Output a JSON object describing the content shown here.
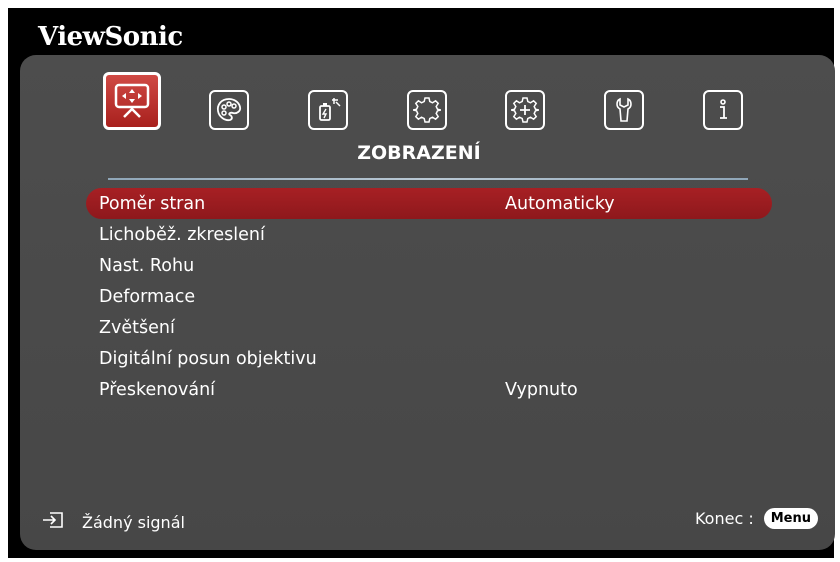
{
  "brand": "ViewSonic",
  "tabs": [
    {
      "name": "display",
      "icon": "display-icon",
      "active": true
    },
    {
      "name": "image",
      "icon": "palette-icon",
      "active": false
    },
    {
      "name": "power",
      "icon": "power-management-icon",
      "active": false
    },
    {
      "name": "basic",
      "icon": "gear-icon",
      "active": false
    },
    {
      "name": "advanced",
      "icon": "advanced-gear-icon",
      "active": false
    },
    {
      "name": "settings",
      "icon": "wrench-icon",
      "active": false
    },
    {
      "name": "information",
      "icon": "info-icon",
      "active": false
    }
  ],
  "section_title": "ZOBRAZENÍ",
  "menu": {
    "items": [
      {
        "label": "Poměr stran",
        "value": "Automaticky",
        "selected": true
      },
      {
        "label": "Lichoběž. zkreslení",
        "value": ""
      },
      {
        "label": "Nast. Rohu",
        "value": ""
      },
      {
        "label": "Deformace",
        "value": ""
      },
      {
        "label": "Zvětšení",
        "value": ""
      },
      {
        "label": "Digitální posun objektivu",
        "value": ""
      },
      {
        "label": "Přeskenování",
        "value": "Vypnuto"
      }
    ]
  },
  "footer": {
    "signal_label": "Žádný signál",
    "exit_label": "Konec :",
    "menu_key": "Menu"
  },
  "colors": {
    "accent": "#a72024",
    "panel": "#4a4a4a",
    "frame": "#000000"
  }
}
